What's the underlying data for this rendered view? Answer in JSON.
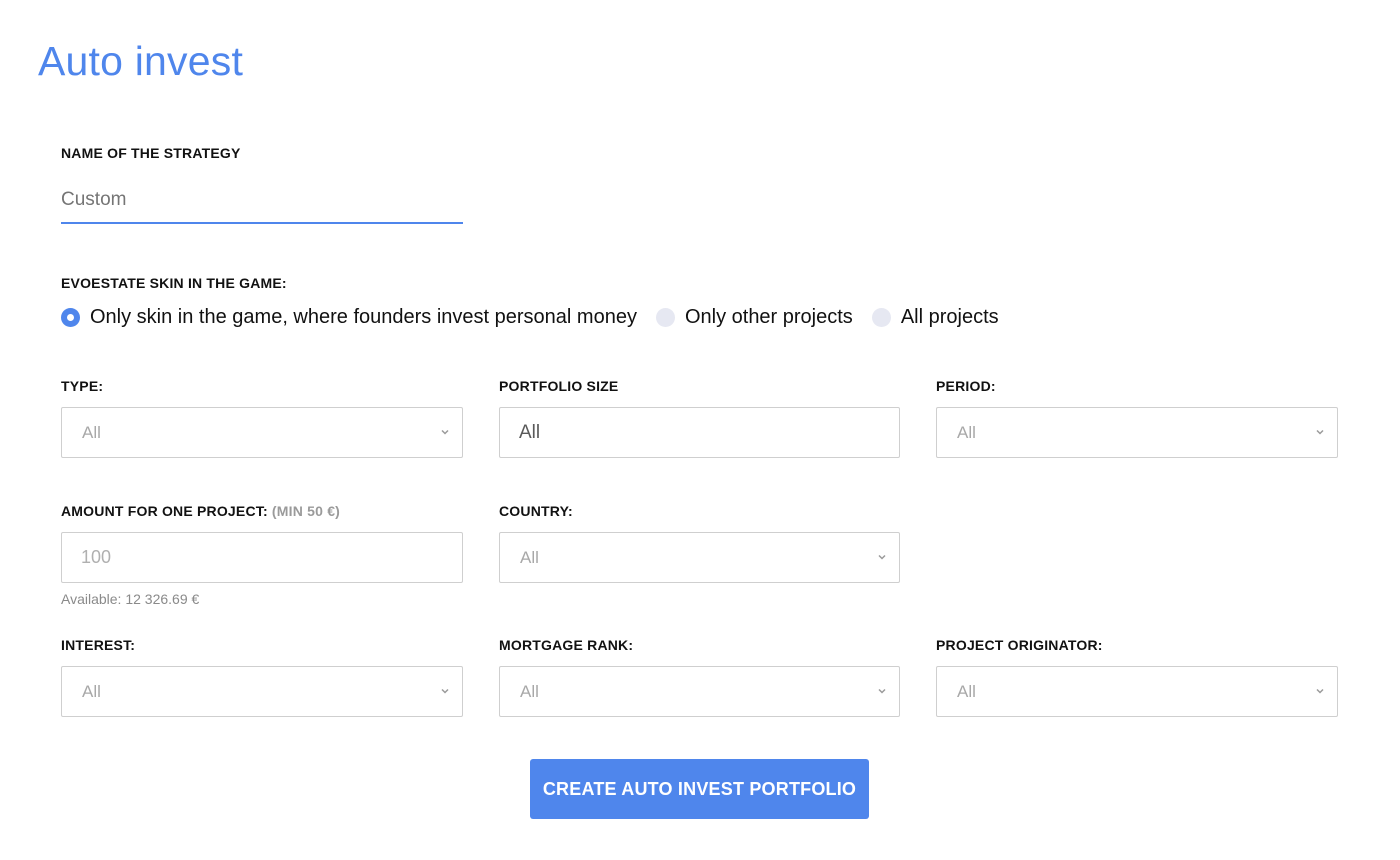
{
  "page": {
    "title": "Auto invest"
  },
  "strategy": {
    "label": "NAME OF THE STRATEGY",
    "placeholder": "Custom"
  },
  "skin": {
    "label": "EVOESTATE SKIN IN THE GAME:",
    "options": [
      {
        "label": "Only skin in the game, where founders invest personal money",
        "checked": true
      },
      {
        "label": "Only other projects",
        "checked": false
      },
      {
        "label": "All projects",
        "checked": false
      }
    ]
  },
  "filters": {
    "type": {
      "label": "TYPE:",
      "value": "All"
    },
    "portfolio_size": {
      "label": "PORTFOLIO SIZE",
      "value": "All"
    },
    "period": {
      "label": "PERIOD:",
      "value": "All"
    },
    "amount": {
      "label": "AMOUNT FOR ONE PROJECT:",
      "label_note": "(MIN 50 €)",
      "placeholder": "100",
      "available": "Available: 12 326.69 €"
    },
    "country": {
      "label": "COUNTRY:",
      "value": "All"
    },
    "interest": {
      "label": "INTEREST:",
      "value": "All"
    },
    "mortgage_rank": {
      "label": "MORTGAGE RANK:",
      "value": "All"
    },
    "project_originator": {
      "label": "PROJECT ORIGINATOR:",
      "value": "All"
    }
  },
  "actions": {
    "create_label": "CREATE AUTO INVEST PORTFOLIO"
  },
  "colors": {
    "accent": "#4f86ec",
    "radio_unchecked": "#e6e8f2",
    "border": "#cfcfcf"
  },
  "icons": {
    "select_arrow": "chevron-down-icon"
  }
}
